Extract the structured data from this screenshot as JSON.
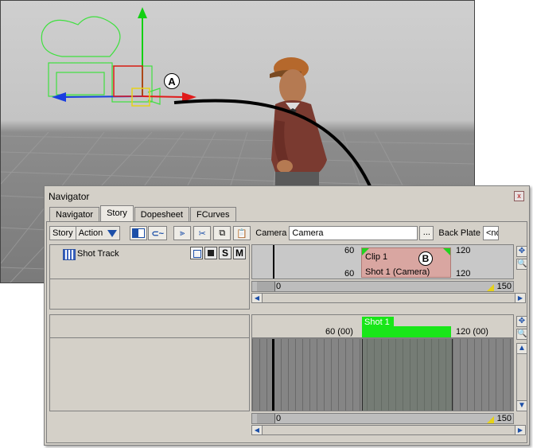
{
  "callouts": {
    "a": "A",
    "b": "B"
  },
  "window": {
    "title": "Navigator",
    "close_glyph": "x"
  },
  "tabs": [
    {
      "label": "Navigator",
      "active": false
    },
    {
      "label": "Story",
      "active": true
    },
    {
      "label": "Dopesheet",
      "active": false
    },
    {
      "label": "FCurves",
      "active": false
    }
  ],
  "toolbar": {
    "story_label": "Story",
    "mode_value": "Action",
    "camera_label": "Camera",
    "camera_value": "Camera",
    "more_label": "...",
    "back_plate_label": "Back Plate",
    "back_plate_value": "<no"
  },
  "shot_track": {
    "name": "Shot Track",
    "buttons": [
      "S",
      "M"
    ],
    "clip_name": "Clip 1",
    "shot_name": "Shot 1 (Camera)",
    "start_frame_top": "60",
    "start_frame_bottom": "60",
    "end_frame_top": "120",
    "end_frame_bottom": "120",
    "clip_color": "#d9a6a1",
    "marker_color": "#1fd41f"
  },
  "upper_range": {
    "start": "0",
    "end": "150"
  },
  "lower_timeline": {
    "shot_label": "Shot 1",
    "tick_60": "60 (00)",
    "tick_120": "120 (00)",
    "shot_color": "#19e619"
  },
  "lower_range": {
    "start": "0",
    "end": "150"
  },
  "icons": {
    "pan": "pan-icon",
    "zoom": "zoom-icon",
    "scroll_up": "scroll-up-icon",
    "scroll_down": "scroll-down-icon"
  }
}
